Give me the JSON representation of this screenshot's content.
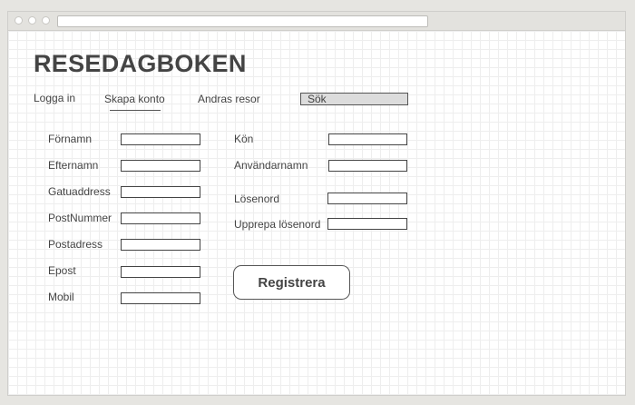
{
  "site": {
    "title": "RESEDAGBOKEN"
  },
  "nav": {
    "login": "Logga in",
    "create_account": "Skapa konto",
    "others_trips": "Andras resor",
    "search_label": "Sök"
  },
  "form": {
    "left": {
      "first_name": "Förnamn",
      "last_name": "Efternamn",
      "street": "Gatuaddress",
      "postal_code": "PostNummer",
      "postal_city": "Postadress",
      "email": "Epost",
      "mobile": "Mobil"
    },
    "right": {
      "gender": "Kön",
      "username": "Användarnamn",
      "password": "Lösenord",
      "repeat_password": "Upprepa lösenord"
    },
    "register_button": "Registrera"
  }
}
